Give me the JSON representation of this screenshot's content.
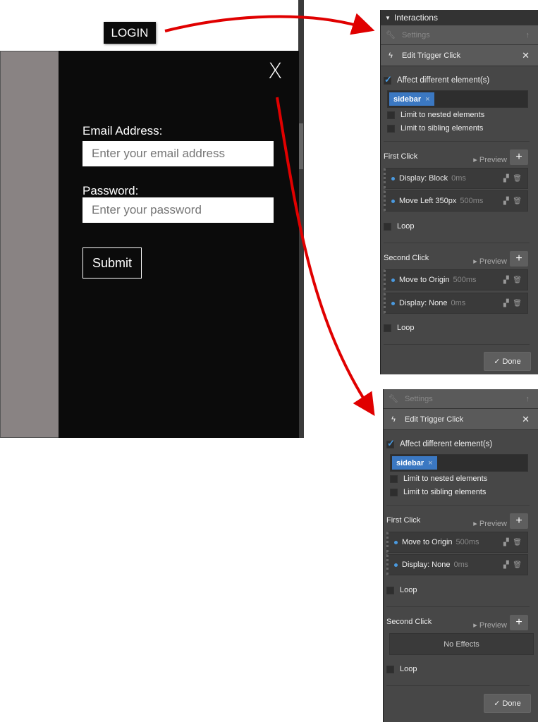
{
  "page": {
    "login_label": "LOGIN",
    "close_glyph": "X",
    "email_label": "Email Address:",
    "email_placeholder": "Enter your email address",
    "password_label": "Password:",
    "password_placeholder": "Enter your password",
    "submit_label": "Submit"
  },
  "panel1": {
    "header": "Interactions",
    "settings": "Settings",
    "trigger": "Edit Trigger Click",
    "affect": "Affect different element(s)",
    "tag": "sidebar",
    "nested": "Limit to nested elements",
    "sibling": "Limit to sibling elements",
    "first_click": "First Click",
    "preview": "Preview",
    "first_effects": [
      {
        "name": "Display: Block",
        "time": "0ms"
      },
      {
        "name": "Move Left 350px",
        "time": "500ms"
      }
    ],
    "loop": "Loop",
    "second_click": "Second Click",
    "second_effects": [
      {
        "name": "Move to Origin",
        "time": "500ms"
      },
      {
        "name": "Display: None",
        "time": "0ms"
      }
    ],
    "done": "Done"
  },
  "panel2": {
    "settings": "Settings",
    "trigger": "Edit Trigger Click",
    "affect": "Affect different element(s)",
    "tag": "sidebar",
    "nested": "Limit to nested elements",
    "sibling": "Limit to sibling elements",
    "first_click": "First Click",
    "preview": "Preview",
    "first_effects": [
      {
        "name": "Move to Origin",
        "time": "500ms"
      },
      {
        "name": "Display: None",
        "time": "0ms"
      }
    ],
    "loop": "Loop",
    "second_click": "Second Click",
    "no_effects": "No Effects",
    "done": "Done"
  },
  "colors": {
    "arrow": "#e00000",
    "accent": "#3b78c2"
  }
}
